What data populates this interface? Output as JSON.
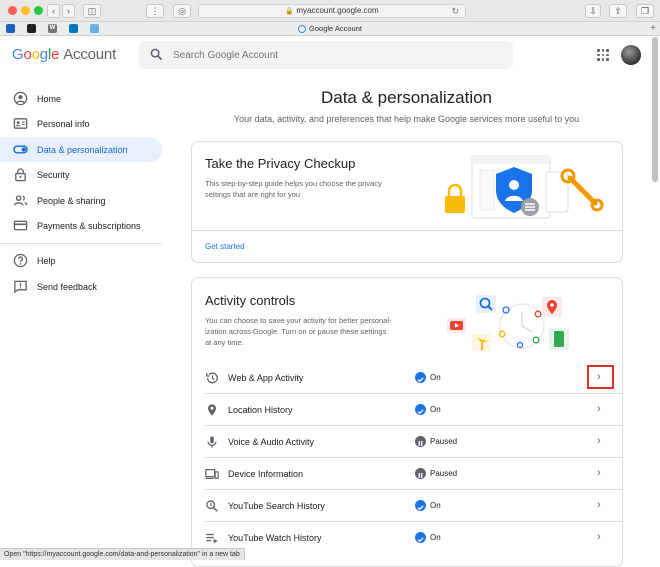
{
  "browser": {
    "url": "myaccount.google.com",
    "tab_title": "Google Account",
    "status_url": "Open \"https://myaccount.google.com/data-and-personalization\" in a new tab",
    "bookmark_icons": [
      "bookmark-icon-blue",
      "apple-icon",
      "wikipedia-icon",
      "trello-icon",
      "weather-icon"
    ]
  },
  "header": {
    "logo_letters": [
      "G",
      "o",
      "o",
      "g",
      "l",
      "e"
    ],
    "logo_suffix": "Account",
    "search_placeholder": "Search Google Account"
  },
  "sidebar": {
    "items": [
      {
        "label": "Home",
        "icon": "account-circle-icon"
      },
      {
        "label": "Personal info",
        "icon": "id-card-icon"
      },
      {
        "label": "Data & personalization",
        "icon": "toggle-icon",
        "active": true
      },
      {
        "label": "Security",
        "icon": "lock-icon"
      },
      {
        "label": "People & sharing",
        "icon": "people-icon"
      },
      {
        "label": "Payments & subscriptions",
        "icon": "credit-card-icon"
      }
    ],
    "secondary": [
      {
        "label": "Help",
        "icon": "help-icon"
      },
      {
        "label": "Send feedback",
        "icon": "feedback-icon"
      }
    ]
  },
  "main": {
    "title": "Data & personalization",
    "subtitle": "Your data, activity, and preferences that help make Google services more useful to you",
    "privacy_card": {
      "title": "Take the Privacy Checkup",
      "description_lines": [
        "This step-by-step guide helps you choose the privacy",
        "settings that are right for you"
      ],
      "link": "Get started"
    },
    "activity_card": {
      "title": "Activity controls",
      "description_lines": [
        "You can choose to save your activity for better personal-",
        "ization across Google. Turn on or pause these settings",
        "at any time."
      ],
      "rows": [
        {
          "label": "Web & App Activity",
          "status": "On",
          "icon": "history-icon"
        },
        {
          "label": "Location History",
          "status": "On",
          "icon": "location-pin-icon"
        },
        {
          "label": "Voice & Audio Activity",
          "status": "Paused",
          "icon": "microphone-icon"
        },
        {
          "label": "Device Information",
          "status": "Paused",
          "icon": "devices-icon"
        },
        {
          "label": "YouTube Search History",
          "status": "On",
          "icon": "search-history-icon"
        },
        {
          "label": "YouTube Watch History",
          "status": "On",
          "icon": "youtube-history-icon"
        }
      ]
    }
  },
  "colors": {
    "accent": "#1a73e8",
    "active_nav_bg": "#e8f0fe",
    "highlight_box": "#d93025",
    "paused_badge": "#5f6368"
  }
}
